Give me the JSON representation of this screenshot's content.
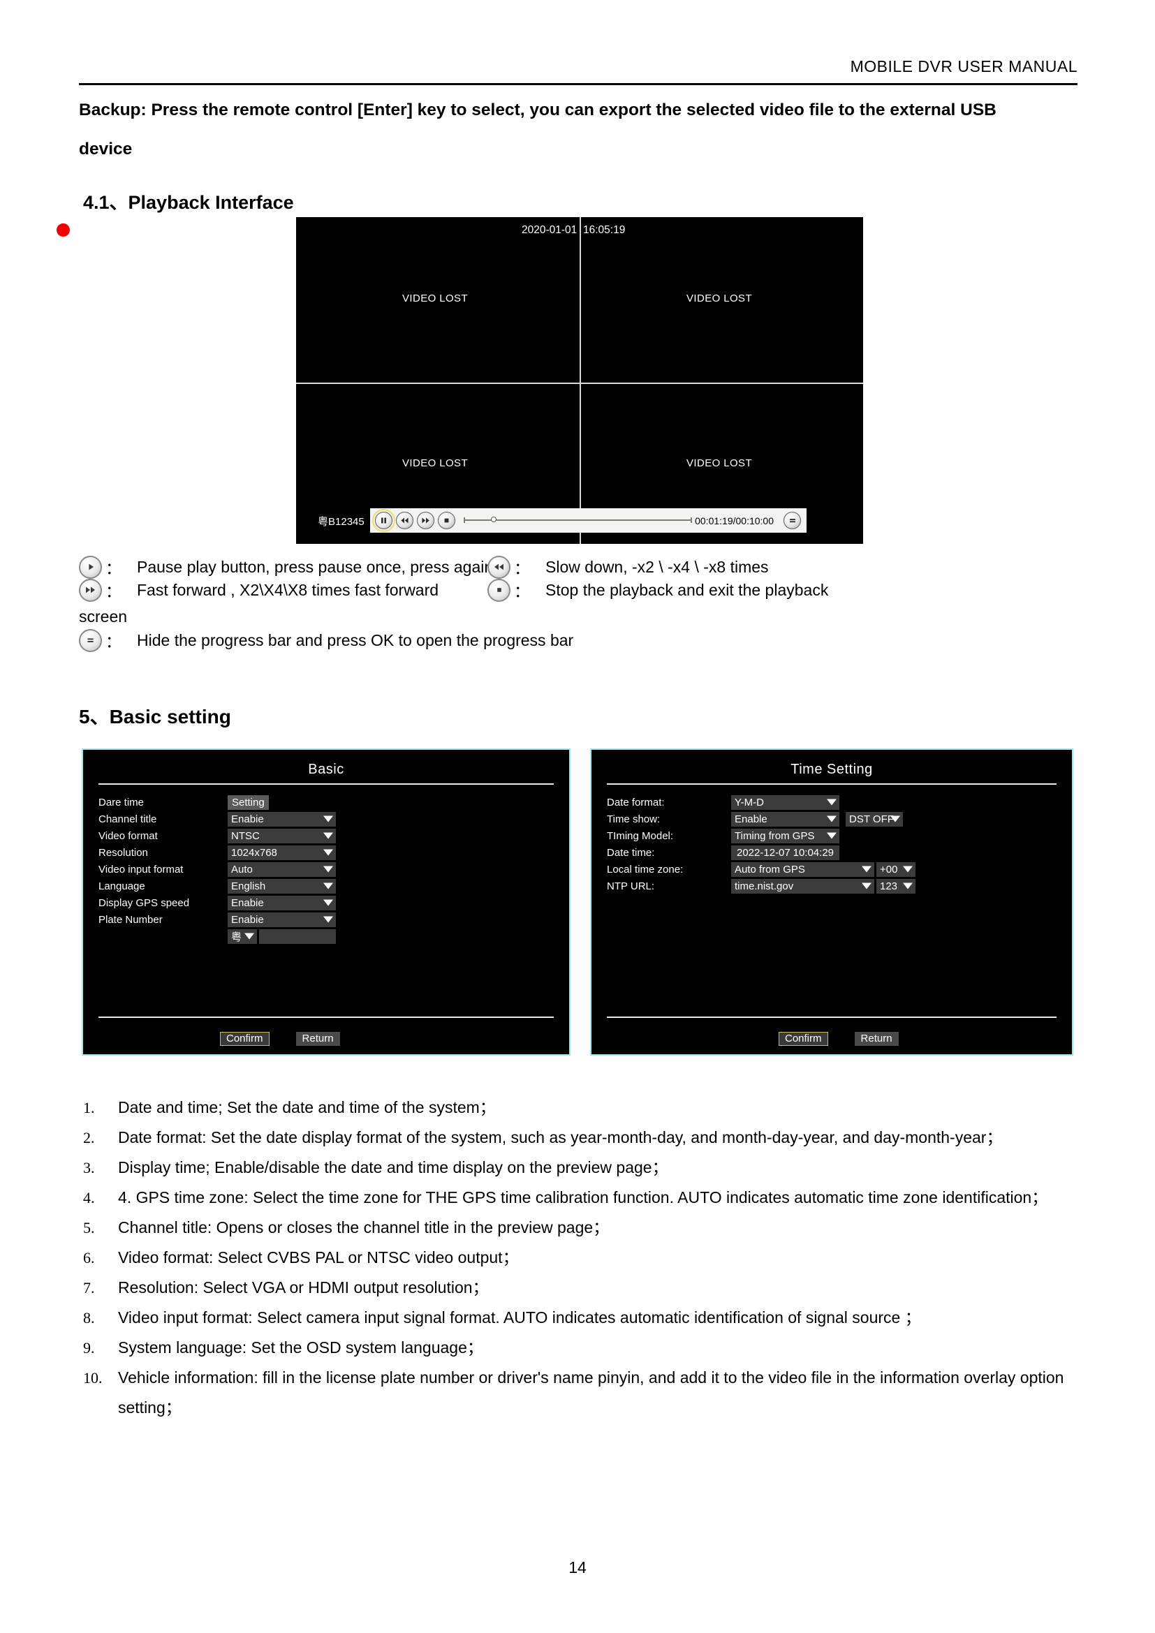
{
  "header": {
    "running_title": "MOBILE  DVR  USER  MANUAL"
  },
  "intro": {
    "paragraph": "Backup: Press the remote control [Enter] key to select, you can export the selected video file to the external USB device"
  },
  "sections": {
    "playback_heading": "4.1、Playback Interface",
    "basic_heading": "5、Basic setting"
  },
  "dvr_preview": {
    "date": "2020-01-01",
    "time": "16:05:19",
    "rec_indicator": "record-dot",
    "channels": [
      {
        "status": "VIDEO LOST"
      },
      {
        "status": "VIDEO LOST"
      },
      {
        "status": "VIDEO LOST"
      },
      {
        "status": "VIDEO LOST"
      }
    ],
    "control_bar": {
      "plate": "粤B12345",
      "buttons": [
        {
          "name": "pause-play",
          "glyph": "pause",
          "focused": true
        },
        {
          "name": "rewind",
          "glyph": "rewind",
          "focused": false
        },
        {
          "name": "fast-forward",
          "glyph": "forward",
          "focused": false
        },
        {
          "name": "stop",
          "glyph": "stop",
          "focused": false
        }
      ],
      "progress_percent": 13,
      "time_readout": "00:01:19/00:10:00",
      "menu_button": "hide-progress-bar"
    }
  },
  "legend": {
    "items": [
      {
        "icon": "play-icon",
        "colon": "：",
        "text": "Pause play button, press pause once, press again"
      },
      {
        "icon": "rewind-icon",
        "colon": "：",
        "text": "Slow down, -x2 \\ -x4 \\ -x8 times"
      },
      {
        "icon": "fast-forward-icon",
        "colon": "：",
        "text": "Fast forward , X2\\X4\\X8 times fast forward"
      },
      {
        "icon": "stop-icon",
        "colon": "：",
        "text": "Stop the playback    and exit the playback"
      },
      {
        "icon": "menu-icon",
        "colon": "：",
        "text": "Hide the progress bar    and press OK to open the progress bar"
      }
    ],
    "wrapped_word": "screen"
  },
  "basic_panel": {
    "title": "Basic",
    "rows": [
      {
        "label": "Dare time",
        "value": "Setting",
        "type": "button"
      },
      {
        "label": "Channel title",
        "value": "Enabie",
        "type": "select"
      },
      {
        "label": "Video format",
        "value": "NTSC",
        "type": "select"
      },
      {
        "label": "Resolution",
        "value": "1024x768",
        "type": "select"
      },
      {
        "label": "Video input format",
        "value": "Auto",
        "type": "select"
      },
      {
        "label": "Language",
        "value": "English",
        "type": "select"
      },
      {
        "label": "Display GPS speed",
        "value": "Enabie",
        "type": "select"
      },
      {
        "label": "Plate Number",
        "value": "Enabie",
        "type": "select"
      }
    ],
    "plate_entry": {
      "province": "粤",
      "number": ""
    },
    "confirm_label": "Confirm",
    "return_label": "Return"
  },
  "time_panel": {
    "title": "Time  Setting",
    "rows": [
      {
        "label": "Date format:",
        "value": "Y-M-D"
      },
      {
        "label": "Time show:",
        "value": "Enable",
        "extra": "DST OFF"
      },
      {
        "label": "TIming Model:",
        "value": "Timing from GPS"
      },
      {
        "label": "Date time:",
        "value": "2022-12-07",
        "value2": "10:04:29"
      },
      {
        "label": "Local time zone:",
        "value": "Auto from GPS",
        "extra": "+00"
      },
      {
        "label": "NTP URL:",
        "value": "time.nist.gov",
        "extra": "123"
      }
    ],
    "confirm_label": "Confirm",
    "return_label": "Return"
  },
  "numbered_list": [
    {
      "num": "1.",
      "text": "Date and time; Set the date and time of the system；"
    },
    {
      "num": "2.",
      "text": "Date format: Set the date display format of the system, such as year-month-day, and month-day-year, and day-month-year；"
    },
    {
      "num": "3.",
      "text": "Display time; Enable/disable the date and time display on the preview page；"
    },
    {
      "num": "4.",
      "text": "4. GPS time zone: Select the time zone for THE GPS time calibration function. AUTO indicates automatic time zone identification；"
    },
    {
      "num": "5.",
      "text": "Channel title: Opens or closes the channel title in the preview page；"
    },
    {
      "num": "6.",
      "text": "Video format: Select CVBS PAL or NTSC video output；"
    },
    {
      "num": "7.",
      "text": "Resolution: Select VGA or HDMI output resolution；"
    },
    {
      "num": "8.",
      "text": "Video input format: Select camera input signal format. AUTO indicates automatic identification of signal source  ；"
    },
    {
      "num": "9.",
      "text": "System language: Set the OSD system language；"
    },
    {
      "num": "10.",
      "text": "Vehicle information: fill in the license plate number or driver's name pinyin, and add it to the video file in the information overlay option setting；"
    }
  ],
  "footer": {
    "page_number": "14"
  },
  "colors": {
    "panel_border": "#9fe4e8",
    "panel_bg": "#000000",
    "field_bg": "#3c3c3c",
    "focus_border": "#c9b95a",
    "rec_dot": "#f40000"
  }
}
